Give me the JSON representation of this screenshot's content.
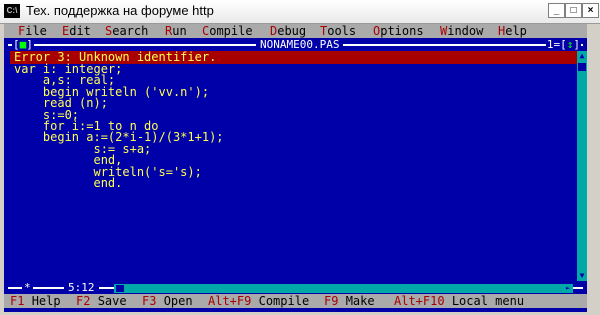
{
  "window": {
    "title": "Тех. поддержка на форуме http",
    "icon_label": "C:\\",
    "buttons": {
      "minimize": "_",
      "maximize": "□",
      "close": "×"
    }
  },
  "menu": [
    {
      "hot": "F",
      "rest": "ile"
    },
    {
      "hot": "E",
      "rest": "dit"
    },
    {
      "hot": "S",
      "rest": "earch"
    },
    {
      "hot": "R",
      "rest": "un"
    },
    {
      "hot": "C",
      "rest": "ompile"
    },
    {
      "hot": "D",
      "rest": "ebug"
    },
    {
      "hot": "T",
      "rest": "ools"
    },
    {
      "hot": "O",
      "rest": "ptions"
    },
    {
      "hot": "W",
      "rest": "indow"
    },
    {
      "hot": "H",
      "rest": "elp"
    }
  ],
  "editor": {
    "close_box_open": "[",
    "close_box_mark": "■",
    "close_box_close": "]",
    "filename": "NONAME00.PAS",
    "window_number": "1=",
    "zoom_box_open": "[",
    "zoom_box_mark": "↕",
    "zoom_box_close": "]",
    "error_message": "Error 3: Unknown identifier.",
    "code_lines": [
      "var i: integer;",
      "    a,s: real;",
      "    begin writeln ('vv.n');",
      "    read (n);",
      "    s:=0;",
      "    for i:=1 to n do",
      "    begin a:=(2*i-1)/(3*1+1);",
      "           s:= s+a;",
      "           end,",
      "           writeln('s='s);",
      "           end."
    ],
    "cursor_position": "5:12",
    "bottom_marker": "*"
  },
  "scroll": {
    "up": "▲",
    "down": "▼",
    "right": "►"
  },
  "status_bar": [
    {
      "key": "F1",
      "label": "Help"
    },
    {
      "key": "F2",
      "label": "Save"
    },
    {
      "key": "F3",
      "label": "Open"
    },
    {
      "key": "Alt+F9",
      "label": "Compile"
    },
    {
      "key": "F9",
      "label": "Make"
    },
    {
      "key": "Alt+F10",
      "label": "Local menu"
    }
  ]
}
